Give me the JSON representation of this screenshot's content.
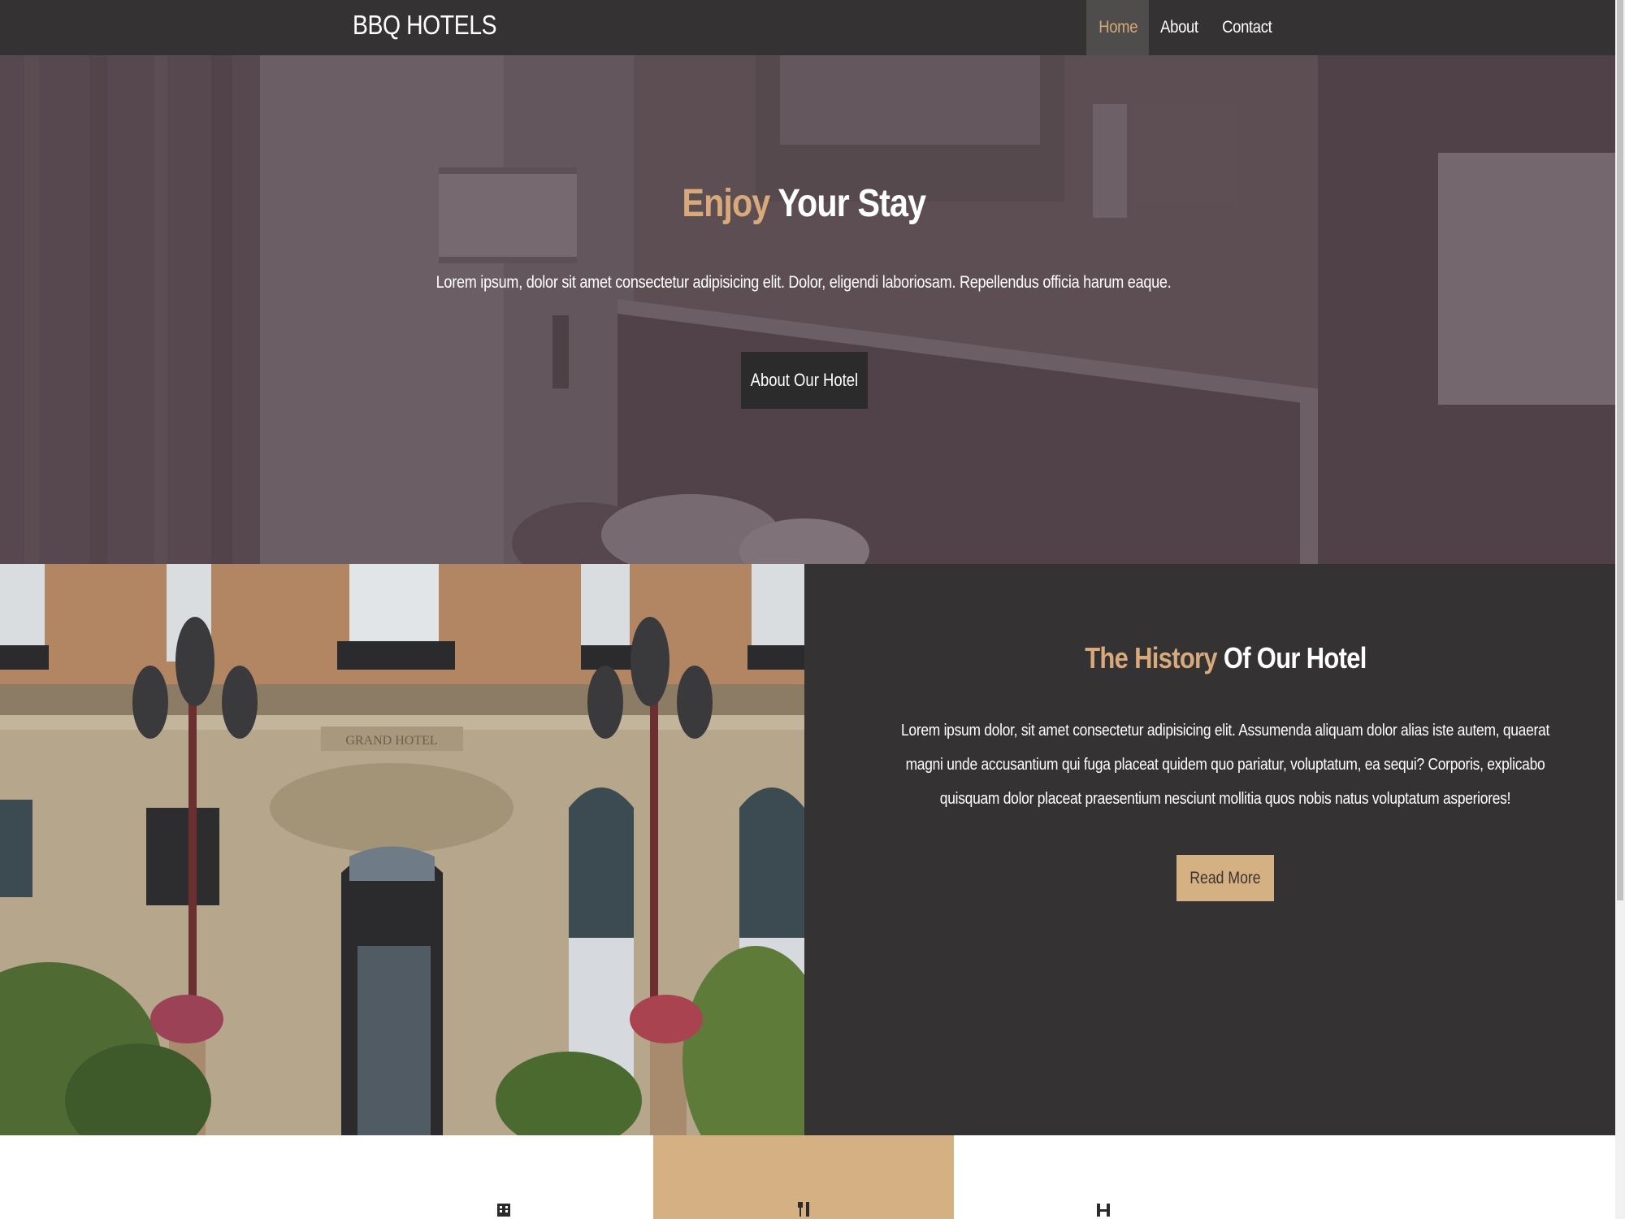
{
  "navbar": {
    "brand": "BBQ HOTELS",
    "links": [
      {
        "label": "Home",
        "active": true
      },
      {
        "label": "About",
        "active": false
      },
      {
        "label": "Contact",
        "active": false
      }
    ]
  },
  "hero": {
    "title_accent": "Enjoy",
    "title_rest": " Your Stay",
    "subtitle": "Lorem ipsum, dolor sit amet consectetur adipisicing elit. Dolor, eligendi laboriosam. Repellendus officia harum eaque.",
    "button_label": "About Our Hotel"
  },
  "history": {
    "image_sign": "GRAND HOTEL",
    "title_accent": "The History",
    "title_rest": " Of Our Hotel",
    "body": "Lorem ipsum dolor, sit amet consectetur adipisicing elit. Assumenda aliquam dolor alias iste autem, quaerat magni unde accusantium qui fuga placeat quidem quo pariatur, voluptatum, ea sequi? Corporis, explicabo quisquam dolor placeat praesentium nesciunt mollitia quos nobis natus voluptatum asperiores!",
    "button_label": "Read More"
  },
  "features": {
    "icons": [
      "building-icon",
      "utensils-icon",
      "dumbbell-icon"
    ]
  },
  "colors": {
    "accent": "#d5b083",
    "dark": "#343232",
    "nav_active_text": "#d4a878"
  }
}
